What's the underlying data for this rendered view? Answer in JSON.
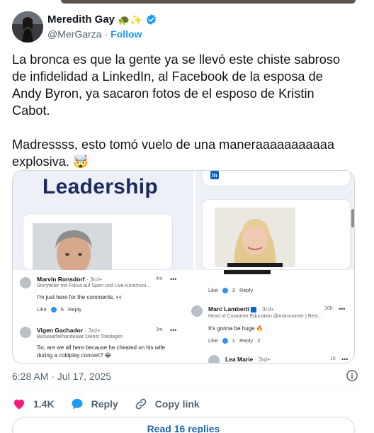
{
  "author": {
    "display_name": "Meredith Gay",
    "emojis": "🐢✨",
    "handle": "@MerGarza",
    "separator": "·",
    "follow_label": "Follow"
  },
  "tweet": {
    "text": "La bronca es que la gente ya se llevó este chiste sabroso de infidelidad a LinkedIn, al Facebook de la esposa de Andy Byron, ya sacaron fotos de el esposo de Kristin Cabot.\n\nMadressss, esto tomó vuelo de una maneraaaaaaaaaaa explosiva. 🤯",
    "timestamp": "6:28 AM · Jul 17, 2025"
  },
  "media": {
    "leadership_title": "Leadership",
    "linkedin_label": "in",
    "left_comments": [
      {
        "name": "Marvin Ronsdorf",
        "meta": " · 3rd+",
        "subtitle": "Storyteller mit Fokus auf Sport und Live-Kommuni...",
        "time": "4m",
        "body": "I'm just here for the comments. 👀",
        "like_label": "Like",
        "like_count": "6",
        "reply_label": "Reply"
      },
      {
        "name": "Vigen Gachador",
        "meta": " · 3rd+",
        "subtitle": "Bezwaarbehandelaar Dienst Toeslagen",
        "time": "3m",
        "body": "So, are we all here because he cheated on his wife during a coldplay concert? 😂"
      }
    ],
    "right_comments": [
      {
        "like_label": "Like",
        "like_count": "3",
        "reply_label": "Reply"
      },
      {
        "name": "Marc Lamberti",
        "meta": " · 3rd+",
        "subtitle": "Head of Customer Education @Astronomer | Best...",
        "time": "20h",
        "body": "It's gonna be huge 🔥",
        "like_label": "Like",
        "like_count": "1",
        "reply_label": "Reply",
        "reply_count": "2"
      },
      {
        "name": "Lea Marie",
        "meta": " · 3rd+",
        "time": "1h"
      }
    ]
  },
  "actions": {
    "like_count": "1.4K",
    "reply_label": "Reply",
    "copy_link_label": "Copy link"
  },
  "read_replies_label": "Read 16 replies",
  "colors": {
    "accent": "#1d9bf0",
    "heart": "#f91880",
    "verified": "#1d9bf0",
    "leadership": "#1c2a5e"
  }
}
